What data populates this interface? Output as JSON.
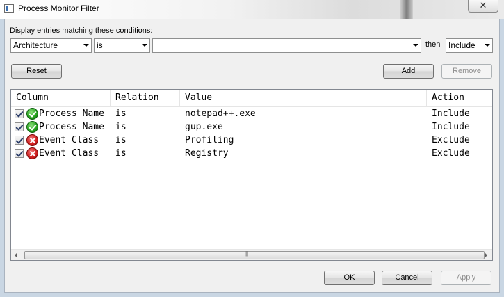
{
  "window": {
    "title": "Process Monitor Filter",
    "close_glyph": "✕"
  },
  "filter": {
    "caption": "Display entries matching these conditions:",
    "column_value": "Architecture",
    "relation_value": "is",
    "value_text": "",
    "then_label": "then",
    "action_value": "Include"
  },
  "buttons": {
    "reset": "Reset",
    "add": "Add",
    "remove": "Remove",
    "ok": "OK",
    "cancel": "Cancel",
    "apply": "Apply"
  },
  "list": {
    "headers": [
      "Column",
      "Relation",
      "Value",
      "Action"
    ],
    "rows": [
      {
        "checked": true,
        "icon": "include-check-icon",
        "column": "Process Name",
        "relation": "is",
        "value": "notepad++.exe",
        "action": "Include"
      },
      {
        "checked": true,
        "icon": "include-check-icon",
        "column": "Process Name",
        "relation": "is",
        "value": "gup.exe",
        "action": "Include"
      },
      {
        "checked": true,
        "icon": "exclude-x-icon",
        "column": "Event Class",
        "relation": "is",
        "value": "Profiling",
        "action": "Exclude"
      },
      {
        "checked": true,
        "icon": "exclude-x-icon",
        "column": "Event Class",
        "relation": "is",
        "value": "Registry",
        "action": "Exclude"
      }
    ]
  },
  "colors": {
    "include": "#22a11b",
    "exclude": "#cf1d1d",
    "window_bg": "#f0f0f0"
  }
}
